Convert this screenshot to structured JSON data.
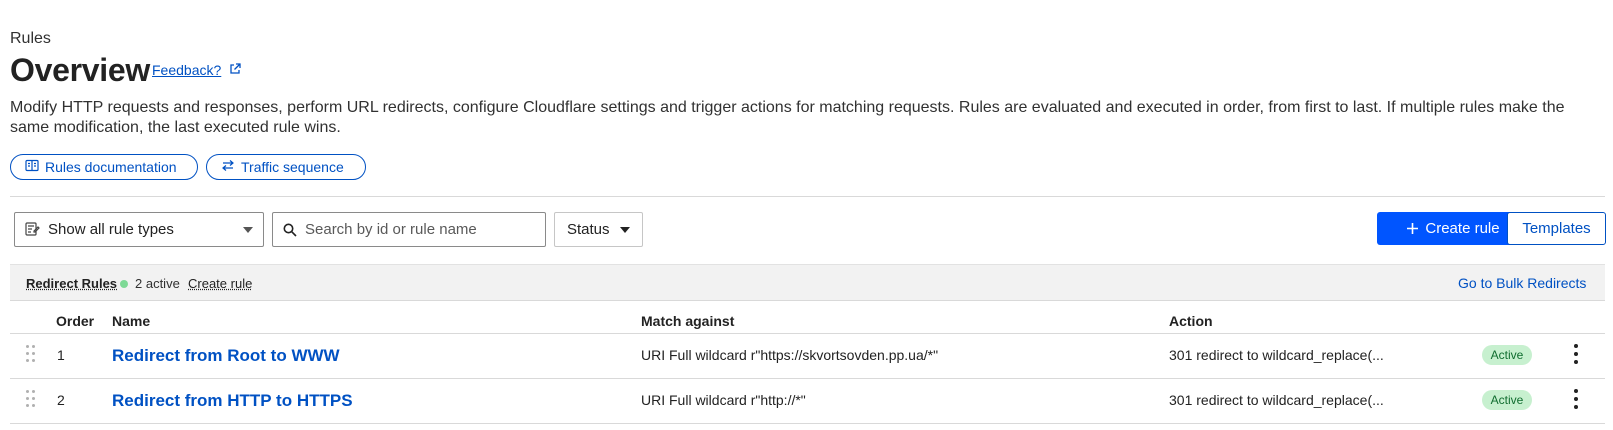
{
  "header": {
    "section": "Rules",
    "title": "Overview",
    "feedback_label": "Feedback?",
    "description": "Modify HTTP requests and responses, perform URL redirects, configure Cloudflare settings and trigger actions for matching requests. Rules are evaluated and executed in order, from first to last. If multiple rules make the same modification, the last executed rule wins."
  },
  "links": {
    "docs_label": "Rules documentation",
    "traffic_label": "Traffic sequence"
  },
  "toolbar": {
    "rule_type_value": "Show all rule types",
    "search_placeholder": "Search by id or rule name",
    "status_label": "Status",
    "create_label": "Create rule",
    "templates_label": "Templates"
  },
  "group": {
    "title": "Redirect Rules",
    "active_count": "2 active",
    "create_label": "Create rule",
    "bulk_label": "Go to Bulk Redirects"
  },
  "table": {
    "headers": {
      "order": "Order",
      "name": "Name",
      "match": "Match against",
      "action": "Action"
    },
    "rows": [
      {
        "order": "1",
        "name": "Redirect from Root to WWW",
        "match": "URI Full wildcard r\"https://skvortsovden.pp.ua/*\"",
        "action": "301 redirect to wildcard_replace(...",
        "status": "Active"
      },
      {
        "order": "2",
        "name": "Redirect from HTTP to HTTPS",
        "match": "URI Full wildcard r\"http://*\"",
        "action": "301 redirect to wildcard_replace(...",
        "status": "Active"
      }
    ]
  },
  "colors": {
    "link_blue": "#0051c3",
    "primary_button": "#0055ff",
    "active_badge_bg": "#c7f0cf",
    "active_dot": "#7ed996"
  },
  "icons": {
    "feedback": "external-link-icon",
    "docs": "book-icon",
    "traffic": "swap-arrows-icon",
    "rule_type": "filter-list-icon",
    "search": "search-icon",
    "create": "plus-icon",
    "drag": "drag-handle-icon",
    "menu": "kebab-menu-icon"
  }
}
